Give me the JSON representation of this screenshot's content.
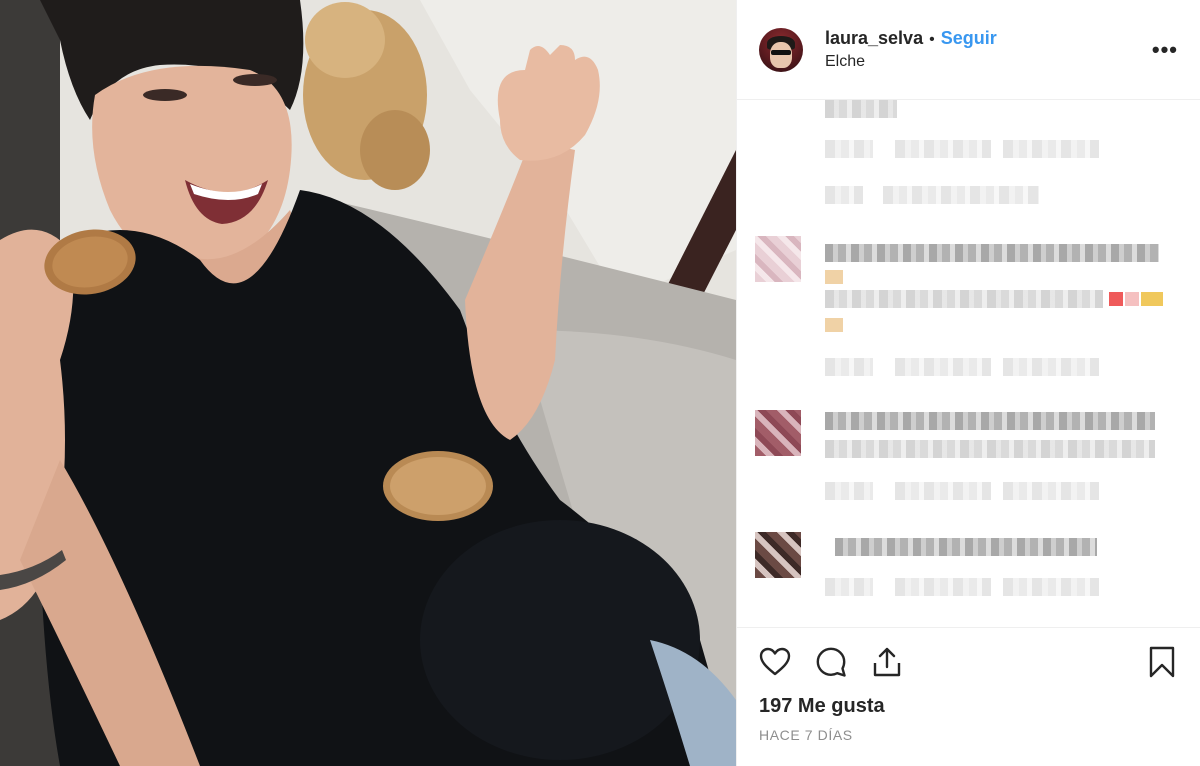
{
  "post": {
    "username": "laura_selva",
    "separator": "•",
    "follow_label": "Seguir",
    "location": "Elche",
    "more_label": "•••",
    "likes": "197 Me gusta",
    "timestamp": "HACE 7 DÍAS"
  },
  "icons": {
    "like": "heart-icon",
    "comment": "comment-icon",
    "share": "share-icon",
    "save": "bookmark-icon",
    "more": "more-icon"
  },
  "colors": {
    "accent": "#3897f0",
    "text": "#262626",
    "muted": "#8e8e8e",
    "divider": "#efefef"
  }
}
